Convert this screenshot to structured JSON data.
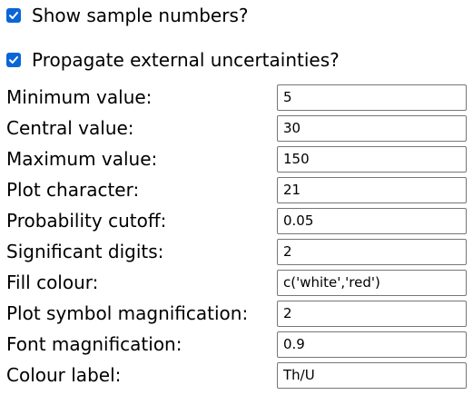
{
  "options": {
    "show_sample_numbers": {
      "label": "Show sample numbers?",
      "checked": true
    },
    "propagate_external": {
      "label": "Propagate external uncertainties?",
      "checked": true
    }
  },
  "fields": [
    {
      "label": "Minimum value:",
      "value": "5"
    },
    {
      "label": "Central value:",
      "value": "30"
    },
    {
      "label": "Maximum value:",
      "value": "150"
    },
    {
      "label": "Plot character:",
      "value": "21"
    },
    {
      "label": "Probability cutoff:",
      "value": "0.05"
    },
    {
      "label": "Significant digits:",
      "value": "2"
    },
    {
      "label": "Fill colour:",
      "value": "c('white','red')"
    },
    {
      "label": "Plot symbol magnification:",
      "value": "2"
    },
    {
      "label": "Font magnification:",
      "value": "0.9"
    },
    {
      "label": "Colour label:",
      "value": "Th/U"
    }
  ],
  "colors": {
    "checkbox_accent": "#0a66d6",
    "input_border": "#767676"
  }
}
